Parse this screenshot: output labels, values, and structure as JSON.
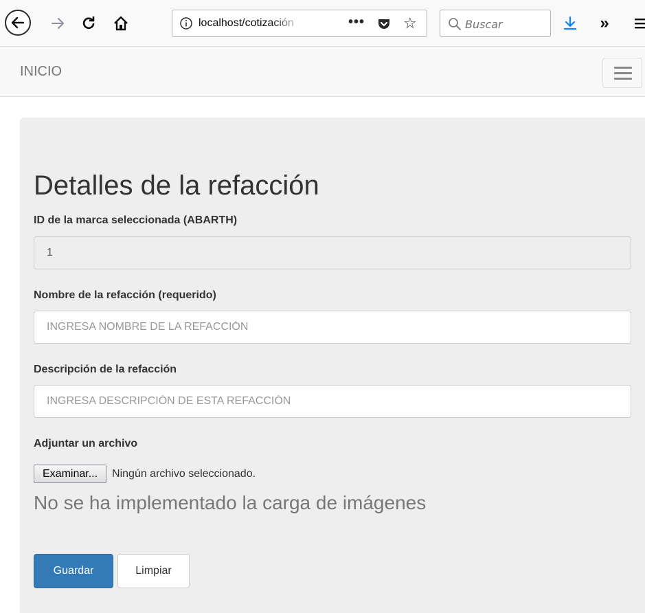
{
  "browser": {
    "url": "localhost/cotización",
    "search_placeholder": "Buscar",
    "more_glyph": "»",
    "page_actions_glyph": "•••"
  },
  "navbar": {
    "brand": "INICIO"
  },
  "form": {
    "title": "Detalles de la refacción",
    "brand_id": {
      "label": "ID de la marca seleccionada (ABARTH)",
      "value": "1"
    },
    "name": {
      "label": "Nombre de la refacción (requerido)",
      "placeholder": "INGRESA NOMBRE DE LA REFACCIÓN",
      "value": ""
    },
    "description": {
      "label": "Descripción de la refacción",
      "placeholder": "INGRESA DESCRIPCIÓN DE ESTA REFACCIÓN",
      "value": ""
    },
    "attachment": {
      "label": "Adjuntar un archivo",
      "button": "Examinar...",
      "status": "Ningún archivo seleccionado."
    },
    "notice": "No se ha implementado la carga de imágenes",
    "save_button": "Guardar",
    "clear_button": "Limpiar"
  },
  "colors": {
    "primary": "#337ab7",
    "panel_bg": "#eeeeee",
    "navbar_bg": "#f8f8f8",
    "download_arrow": "#0a84ff"
  },
  "icons": [
    "back-arrow-icon",
    "forward-arrow-icon",
    "reload-icon",
    "home-icon",
    "info-icon",
    "pocket-icon",
    "bookmark-star-icon",
    "search-icon",
    "download-icon",
    "overflow-icon",
    "hamburger-menu-icon"
  ]
}
